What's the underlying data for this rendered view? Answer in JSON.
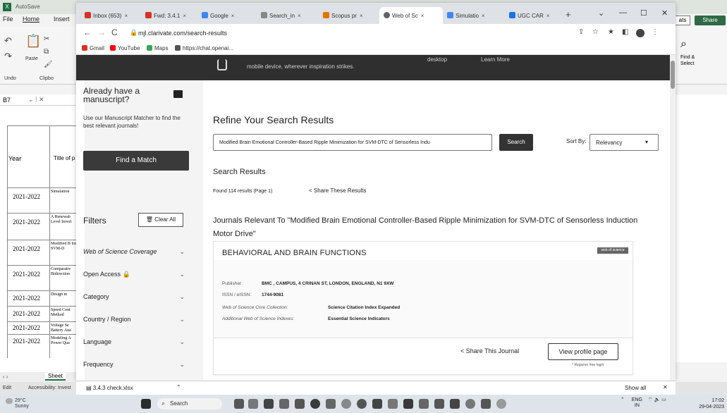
{
  "excel": {
    "title": "AutoSave",
    "menu": [
      "File",
      "Home",
      "Insert"
    ],
    "ribbon": {
      "undo_label": "Undo",
      "paste_label": "Paste",
      "clipboard_label": "Clipbo"
    },
    "right_ribbon": {
      "find_label": "Find &",
      "select_label": "Select",
      "share_label": "Share",
      "ats_label": "ats"
    },
    "name_box": "B7",
    "headers": {
      "year": "Year",
      "title": "Title of p"
    },
    "rows": [
      {
        "year": "2021-2022",
        "title": "Simulation"
      },
      {
        "year": "2021-2022",
        "title": "A Renewab Level Invert"
      },
      {
        "year": "2021-2022",
        "title": "Modified B for SVM-D"
      },
      {
        "year": "2021-2022",
        "title": "Comparativ Bidirection"
      },
      {
        "year": "2021-2022",
        "title": "Design m"
      },
      {
        "year": "2021-2022",
        "title": "Speed Cont Method"
      },
      {
        "year": "2021-2022",
        "title": "Voltage Se Battery Ana"
      },
      {
        "year": "2021-2022",
        "title": "Modeling A Power Qua"
      }
    ],
    "sheet_tab": "Sheet",
    "status_left": "Edit",
    "status_accessibility": "Accessibility: Invest"
  },
  "browser": {
    "tabs": [
      {
        "label": "Inbox (653)",
        "color": "#d93025"
      },
      {
        "label": "Fwd: 3.4.1",
        "color": "#d93025"
      },
      {
        "label": "Google",
        "color": "#4285f4"
      },
      {
        "label": "Search_in",
        "color": "#888888"
      },
      {
        "label": "Scopus pr",
        "color": "#e37400"
      },
      {
        "label": "Web of Sc",
        "color": "#5f6368",
        "active": true
      },
      {
        "label": "Simulatio",
        "color": "#4285f4"
      },
      {
        "label": "UGC CAR",
        "color": "#1a73e8"
      }
    ],
    "new_tab": "+",
    "url": "mjl.clarivate.com/search-results",
    "bookmarks": [
      {
        "label": "Gmail",
        "color": "#d93025"
      },
      {
        "label": "YouTube",
        "color": "#ff0000"
      },
      {
        "label": "Maps",
        "color": "#34a853"
      },
      {
        "label": "https://chat.openai...",
        "color": "#555555"
      }
    ]
  },
  "banner": {
    "text": "mobile device, wherever inspiration strikes.",
    "link1": "desktop",
    "link2": "Learn More"
  },
  "sidebar": {
    "promo_title": "Already have a manuscript?",
    "promo_text": "Use our Manuscript Matcher to find the best relevant journals!",
    "find_match": "Find a Match",
    "filters_title": "Filters",
    "clear_all": "Clear All",
    "filters": [
      {
        "label": "Web of Science Coverage",
        "italic": true
      },
      {
        "label": "Open Access 🔒",
        "italic": false
      },
      {
        "label": "Category",
        "italic": false
      },
      {
        "label": "Country / Region",
        "italic": false
      },
      {
        "label": "Language",
        "italic": false
      },
      {
        "label": "Frequency",
        "italic": false
      }
    ]
  },
  "main": {
    "refine_title": "Refine Your Search Results",
    "search_value": "Modified Brain Emotional Controller-Based Ripple Minimization for SVM-DTC of Sensorless Indu",
    "search_button": "Search",
    "sort_by_label": "Sort By:",
    "sort_by_value": "Relevancy",
    "results_title": "Search Results",
    "found_text": "Found 114 results (Page 1)",
    "share_results": "Share These Results",
    "relevant_heading": "Journals Relevant To \"Modified Brain Emotional Controller-Based Ripple Minimization for SVM-DTC of Sensorless Induction Motor Drive\""
  },
  "journal": {
    "name": "BEHAVIORAL AND BRAIN FUNCTIONS",
    "badge": "web of science",
    "fields": [
      {
        "key": "Publisher:",
        "value": "BMC , CAMPUS, 4 CRINAN ST, LONDON, ENGLAND, N1 9XW"
      },
      {
        "key": "ISSN / eISSN:",
        "value": "1744-9081"
      },
      {
        "key": "Web of Science Core Collection:",
        "value": "Science Citation Index Expanded"
      },
      {
        "key": "Additional Web of Science Indexes:",
        "value": "Essential Science Indicators"
      }
    ],
    "share_journal": "Share This Journal",
    "view_profile": "View profile page",
    "login_note": "* Requires free login."
  },
  "downloads": {
    "file": "3.4.3 check.xlsx",
    "show_all": "Show all"
  },
  "taskbar": {
    "temp": "29°C",
    "weather": "Sunny",
    "search": "Search",
    "lang": "ENG",
    "region": "IN",
    "time": "17:02",
    "date": "29-04-2023"
  }
}
